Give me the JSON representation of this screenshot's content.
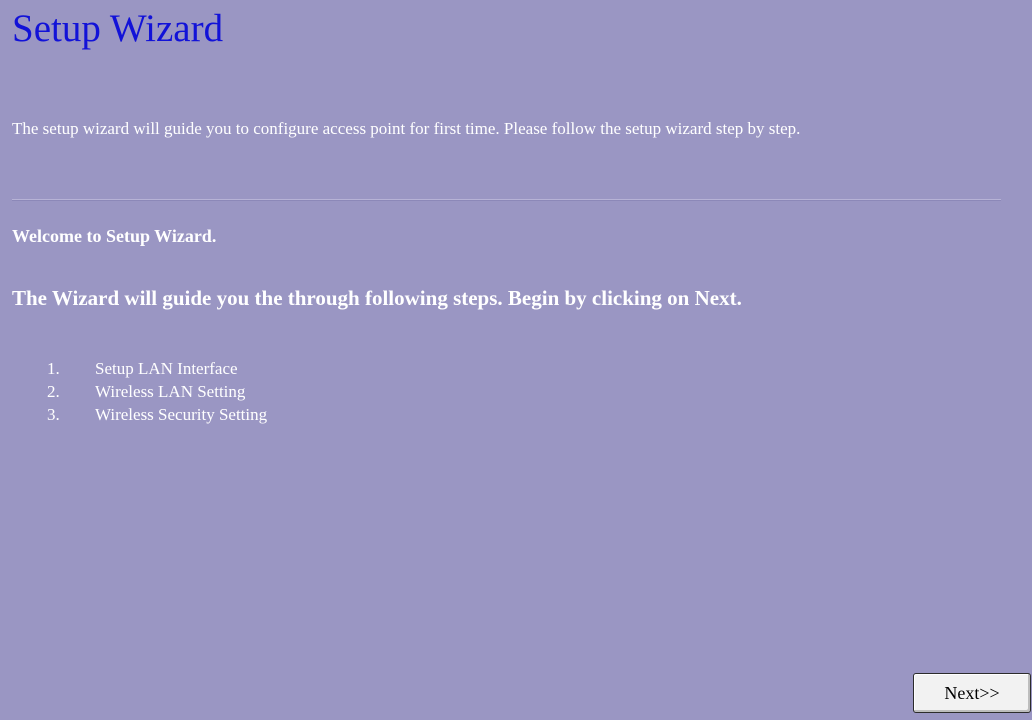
{
  "header": {
    "title": "Setup Wizard"
  },
  "intro": {
    "text": "The setup wizard will guide you to configure access point for first time. Please follow the setup wizard step by step."
  },
  "welcome": {
    "text": "Welcome to Setup Wizard."
  },
  "guide": {
    "text": "The Wizard will guide you the through following steps. Begin by clicking on Next."
  },
  "steps": [
    {
      "number": "1.",
      "label": "Setup LAN Interface"
    },
    {
      "number": "2.",
      "label": "Wireless LAN Setting"
    },
    {
      "number": "3.",
      "label": "Wireless Security Setting"
    }
  ],
  "footer": {
    "next_label": "Next>>"
  },
  "colors": {
    "background": "#9a96c3",
    "title": "#1212d8",
    "text": "#ffffff"
  }
}
